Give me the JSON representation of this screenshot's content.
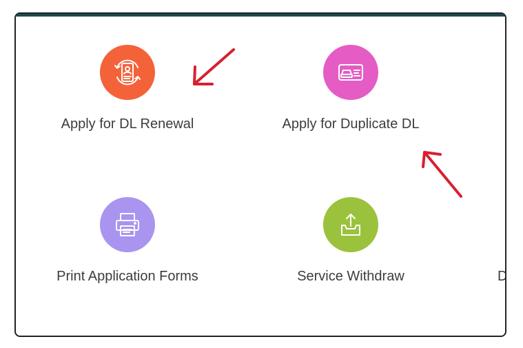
{
  "services": [
    {
      "label": "Apply for DL Renewal",
      "icon": "driver-license-renewal-icon",
      "color": "#f4623a"
    },
    {
      "label": "Apply for Duplicate DL",
      "icon": "driving-license-card-icon",
      "color": "#e55cc4"
    },
    {
      "label": "Print Application Forms",
      "icon": "printer-icon",
      "color": "#a994ef"
    },
    {
      "label": "Service Withdraw",
      "icon": "upload-withdraw-icon",
      "color": "#9bc23c"
    }
  ],
  "partial_service": {
    "label": "D"
  },
  "annotations": {
    "arrow_color": "#d81f30"
  }
}
